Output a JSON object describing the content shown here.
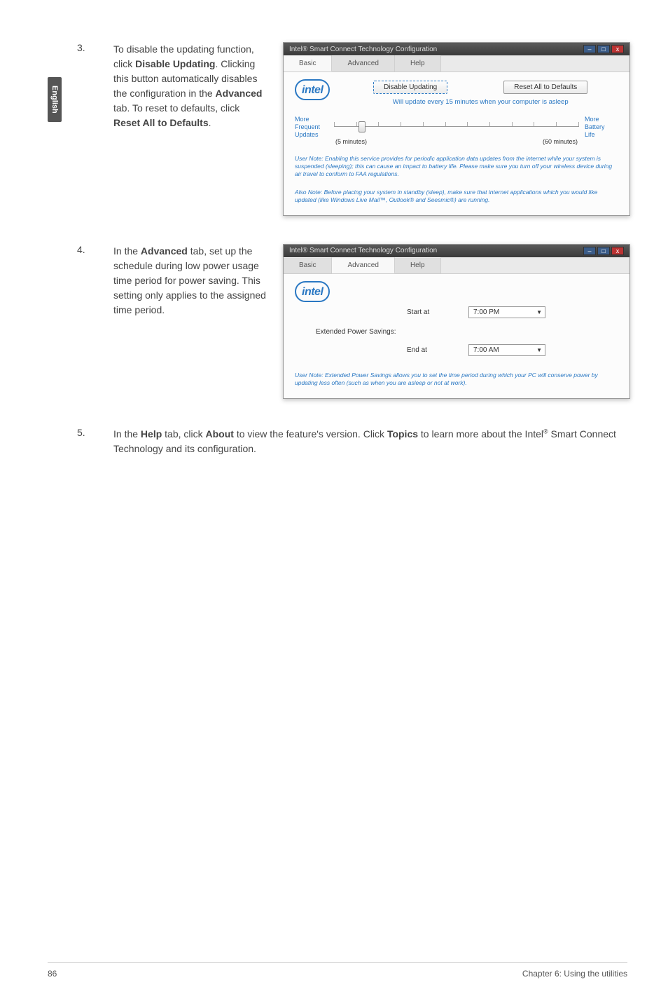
{
  "side_tab": "English",
  "steps": {
    "s3": {
      "num": "3.",
      "part1": "To disable the updating function, click ",
      "b1": "Disable Updating",
      "part2": ". Clicking this button automatically disables the configuration in the ",
      "b2": "Advanced",
      "part3": " tab. To reset to defaults, click ",
      "b3": "Reset All to Defaults",
      "part4": "."
    },
    "s4": {
      "num": "4.",
      "part1": "In the ",
      "b1": "Advanced",
      "part2": " tab, set up the schedule during low power usage time period for power saving. This setting only applies to the assigned time period."
    },
    "s5": {
      "num": "5.",
      "part1": "In the ",
      "b1": "Help",
      "part2": " tab, click ",
      "b2": "About",
      "part3": " to view the feature's version. Click ",
      "b3": "Topics",
      "part4": " to learn more about the Intel",
      "sup": "®",
      "part5": " Smart Connect Technology and its configuration."
    }
  },
  "win1": {
    "title": "Intel® Smart Connect Technology Configuration",
    "tabs": {
      "basic": "Basic",
      "advanced": "Advanced",
      "help": "Help"
    },
    "btn_disable": "Disable Updating",
    "btn_reset": "Reset All to Defaults",
    "will_update": "Will update every 15 minutes when your computer is asleep",
    "left_label_line1": "More",
    "left_label_line2": "Frequent",
    "left_label_line3": "Updates",
    "right_label_line1": "More",
    "right_label_line2": "Battery",
    "right_label_line3": "Life",
    "scale_left": "(5 minutes)",
    "scale_right": "(60 minutes)",
    "note1": "User Note: Enabling this service provides for periodic application data updates from the internet while your system is suspended (sleeping); this can cause an impact to battery life. Please make sure you turn off your wireless device during air travel to conform to FAA regulations.",
    "note2": "Also Note: Before placing your system in standby (sleep), make sure that internet applications which you would like updated (like Windows Live Mail™, Outlook® and Seesmic®) are running."
  },
  "win2": {
    "title": "Intel® Smart Connect Technology Configuration",
    "tabs": {
      "basic": "Basic",
      "advanced": "Advanced",
      "help": "Help"
    },
    "eps": "Extended Power Savings:",
    "start_at": "Start at",
    "start_val": "7:00 PM",
    "end_at": "End at",
    "end_val": "7:00 AM",
    "note": "User Note: Extended Power Savings allows you to set the time period during which your PC will conserve power by updating less often (such as when you are asleep or not at work)."
  },
  "footer": {
    "page": "86",
    "chapter": "Chapter 6: Using the utilities"
  },
  "logo": "intel"
}
